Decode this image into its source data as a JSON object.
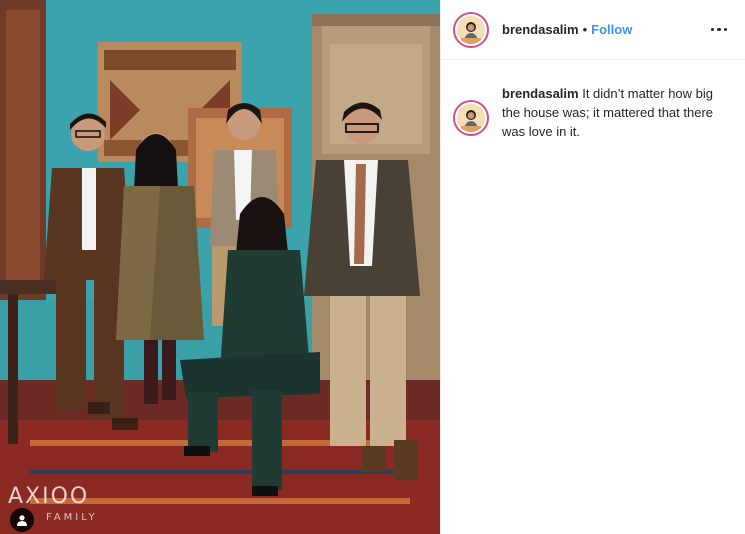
{
  "post": {
    "username": "brendasalim",
    "separator": "•",
    "follow_label": "Follow",
    "more_icon": "more-horizontal-icon",
    "caption": {
      "username": "brendasalim",
      "text": "It didn’t matter how big the house was; it mattered that there was love in it."
    }
  },
  "photo": {
    "watermark": "AXIOO",
    "watermark_sub": "FAMILY",
    "user_tag_icon": "user-tag-icon"
  },
  "colors": {
    "accent_link": "#3897f0",
    "avatar_ring": "#d64f86",
    "wall": "#3aa0a8",
    "rug": "#8a2a22"
  }
}
